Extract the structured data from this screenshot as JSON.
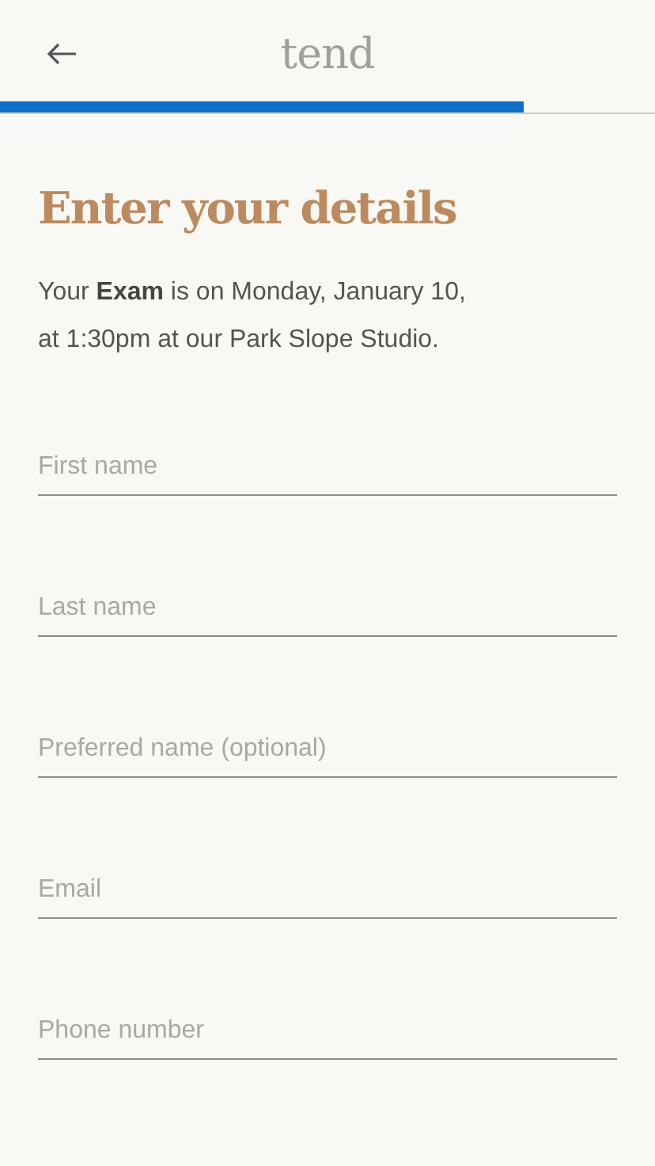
{
  "header": {
    "logo": "tend",
    "progress": {
      "level": 0.8
    }
  },
  "title": "Enter your details",
  "description": "Your **Exam** is on Monday, January 10, at 1:30pm at our Park Slope Studio.",
  "fields": [
    {
      "placeholder": "First name"
    },
    {
      "placeholder": "Last name"
    },
    {
      "placeholder": "Preferred name (optional)"
    },
    {
      "placeholder": "Email"
    },
    {
      "placeholder": "Phone number"
    }
  ]
}
